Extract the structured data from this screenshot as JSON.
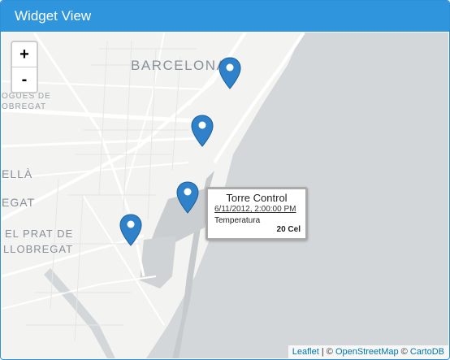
{
  "header": {
    "title": "Widget View"
  },
  "map": {
    "zoom_in_label": "+",
    "zoom_out_label": "-",
    "labels": {
      "barcelona": "BARCELONA",
      "hospitalet_line1": "OGUES DE",
      "hospitalet_line2": "OBREGAT",
      "cornella_line1": "ELLÀ",
      "cornella_line2": "EGAT",
      "prat_line1": "EL PRAT DE",
      "prat_line2": "LLOBREGAT"
    },
    "marker_color": "#2f82c9",
    "water_color": "#d4d7d9",
    "land_color": "#f3f3f2"
  },
  "popup": {
    "title": "Torre Control",
    "date": "6/11/2012, 2:00:00 PM",
    "label": "Temperatura",
    "value": "20 Cel"
  },
  "attribution": {
    "leaflet": "Leaflet",
    "sep1": " | © ",
    "osm": "OpenStreetMap",
    "sep2": " © ",
    "cartodb": "CartoDB"
  }
}
